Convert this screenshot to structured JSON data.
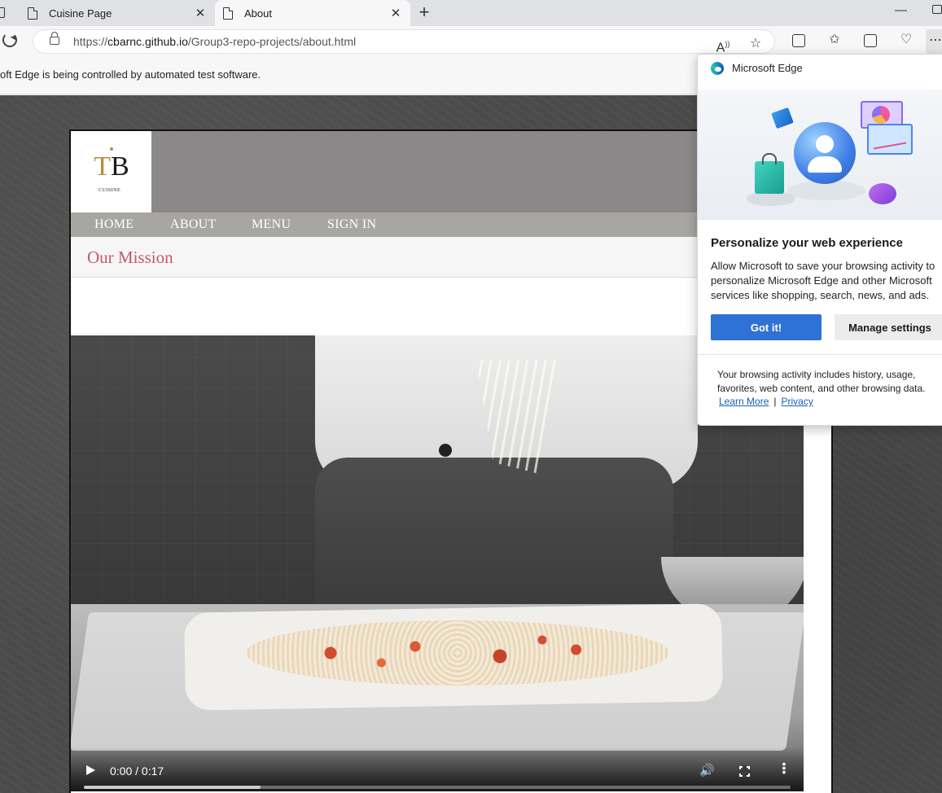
{
  "browser": {
    "tabs": [
      {
        "label": "Cuisine Page",
        "active": false
      },
      {
        "label": "About",
        "active": true
      }
    ],
    "address": {
      "protocol": "https://",
      "host": "cbarnc.github.io",
      "path": "/Group3-repo-projects/about.html"
    },
    "infobar": "oft Edge is being controlled by automated test software."
  },
  "site": {
    "logo": {
      "mark": "B",
      "sub": "CUISINE"
    },
    "nav": [
      "HOME",
      "ABOUT",
      "MENU",
      "SIGN IN"
    ],
    "section_title": "Our Mission",
    "video": {
      "time": "0:00 / 0:17",
      "buffered_fraction": 0.25,
      "playing": false
    }
  },
  "popup": {
    "app": "Microsoft Edge",
    "heading": "Personalize your web experience",
    "body": "Allow Microsoft to save your browsing activity to personalize Microsoft Edge and other Microsoft services like shopping, search, news, and ads.",
    "primary_button": "Got it!",
    "secondary_button": "Manage settings",
    "footer": "Your browsing activity includes history, usage, favorites, web content, and other browsing data.",
    "links": {
      "learn_more": "Learn More",
      "separator": "|",
      "privacy": "Privacy"
    }
  },
  "colors": {
    "accent": "#2f72d6",
    "mission_title": "#c05a6c",
    "header_gray": "#8a8888",
    "nav_gray": "#a8a6a2",
    "logo_gold": "#b58d42"
  }
}
